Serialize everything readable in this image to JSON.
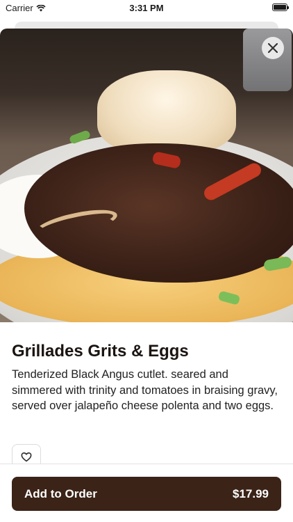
{
  "status_bar": {
    "carrier": "Carrier",
    "time": "3:31 PM",
    "battery_level": 1.0
  },
  "item": {
    "name": "Grillades Grits & Eggs",
    "description": "Tenderized Black Angus cutlet. seared and simmered with trinity and tomatoes in braising gravy, served over jalapeño cheese polenta and two eggs."
  },
  "icons": {
    "close": "close-icon",
    "favorite": "heart-outline-icon",
    "wifi": "wifi-icon"
  },
  "order_button": {
    "label": "Add to Order",
    "price": "$17.99"
  },
  "colors": {
    "order_button_bg": "#3b2318",
    "order_button_text": "#ffffff"
  }
}
